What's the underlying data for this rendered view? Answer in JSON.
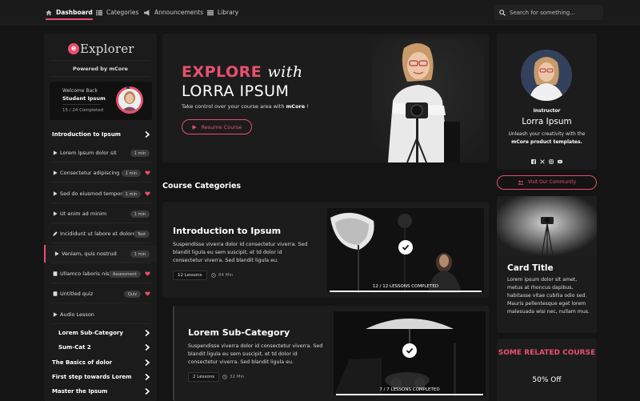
{
  "nav": {
    "items": [
      {
        "label": "Dashboard",
        "icon": "home-icon",
        "active": true
      },
      {
        "label": "Categories",
        "icon": "list-icon"
      },
      {
        "label": "Announcements",
        "icon": "megaphone-icon"
      },
      {
        "label": "Library",
        "icon": "library-icon"
      }
    ],
    "search_placeholder": "Search for something..."
  },
  "sidebar": {
    "logo": "Explorer",
    "logo_mark": "e",
    "powered_by": "Powered by mCore",
    "welcome": {
      "line1": "Welcome Back",
      "name": "Student Ipsum",
      "progress": "15 / 24  Completed",
      "progress_fraction": 0.625
    },
    "rows": [
      {
        "label": "Introduction to Ipsum",
        "type": "header"
      },
      {
        "label": "Lorem Ipsum dolor sit",
        "type": "video",
        "badge": "1 min"
      },
      {
        "label": "Consectetur adipiscing elit",
        "type": "video",
        "badge": "1 min",
        "heart": true
      },
      {
        "label": "Sed do eiusmod tempor",
        "type": "video",
        "badge": "1 min",
        "heart": true
      },
      {
        "label": "Ut enim ad minim",
        "type": "video",
        "badge": "1 min"
      },
      {
        "label": "Incididunt ut labore et dolore",
        "type": "text",
        "badge": "Text"
      },
      {
        "label": "Veniam, quis nostrud",
        "type": "video",
        "badge": "1 min",
        "active": true
      },
      {
        "label": "Ullamco laboris nisi ut",
        "type": "assessment",
        "badge": "Assessment",
        "heart": true
      },
      {
        "label": "Untitled quiz",
        "type": "quiz",
        "badge": "Quiz",
        "heart": true
      },
      {
        "label": "Audio Lesson",
        "type": "audio"
      },
      {
        "label": "Lorem Sub-Category",
        "type": "sub"
      },
      {
        "label": "Sum-Cat 2",
        "type": "sub"
      },
      {
        "label": "The Basics of dolor",
        "type": "header"
      },
      {
        "label": "First step towards Lorem",
        "type": "header"
      },
      {
        "label": "Master the Ipsum",
        "type": "header"
      }
    ]
  },
  "hero": {
    "title_a": "EXPLORE",
    "title_b": "with",
    "title_line2": "LORRA IPSUM",
    "desc": "Take control over your course area with ",
    "desc_bold": "mCore",
    "desc_end": " !",
    "button": "Resume Course"
  },
  "section_title": "Course Categories",
  "courses": [
    {
      "title": "Introduction to Ipsum",
      "desc": "Suspendisse viverra dolor id consectetur viverra. Sed blandit ligula eu sem suscipit, et td dolor id consectetur viverra. Sed blandit ligula eu.",
      "lessons": "12 Lessons",
      "duration": "84 Min",
      "completed": "12 / 12  LESSONS COMPLETED"
    },
    {
      "title": "Lorem Sub-Category",
      "desc": "Suspendisse viverra dolor id consectetur viverra. Sed blandit ligula eu sem suscipit, et td dolor id consectetur viverra. Sed blandit ligula eu.",
      "lessons": "2 Lessons",
      "duration": "32 Min",
      "completed": "7 / 7  LESSONS COMPLETED"
    }
  ],
  "instructor": {
    "label": "Instructor",
    "name": "Lorra Ipsum",
    "bio": "Unleash your creativity with the ",
    "bio_bold": "mCore product templates.",
    "socials": [
      "facebook-icon",
      "x-icon",
      "instagram-icon",
      "youtube-icon"
    ],
    "community_button": "Visit Our Community"
  },
  "card": {
    "title": "Card Title",
    "body": "Lorem ipsum dolor sit amet, metus at rhoncus dapibus, habitasse vitae cubilia odio sed. Mauris pellentesque eget lorem malesuada wisi nec, nullam mus."
  },
  "related": {
    "title": "SOME RELATED COURSE",
    "offer": "50% Off"
  },
  "colors": {
    "accent": "#e8506f",
    "background": "#141414",
    "card": "#1c1c1c"
  }
}
